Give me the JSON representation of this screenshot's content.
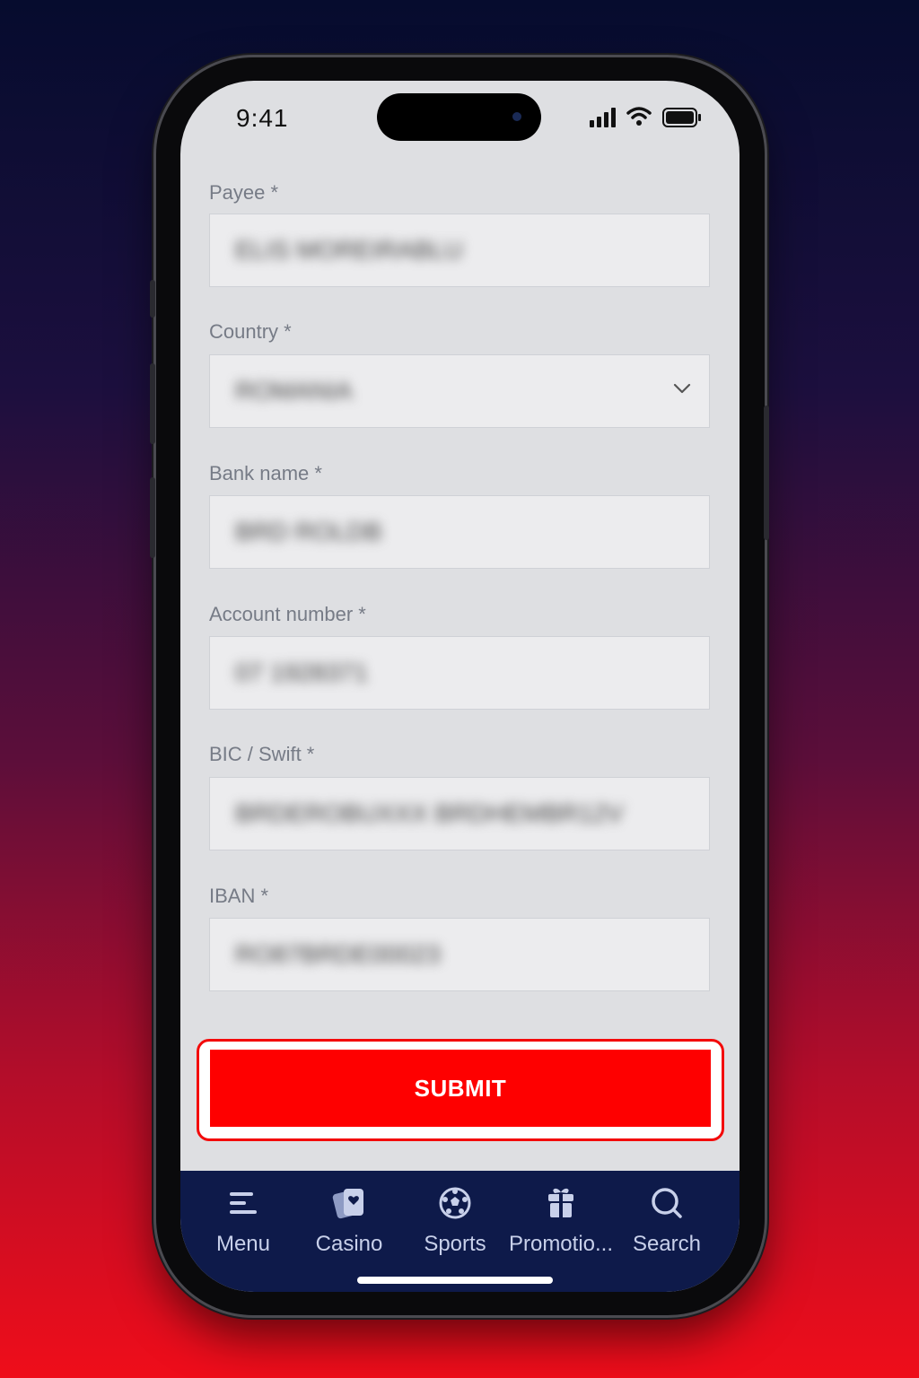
{
  "status_bar": {
    "time": "9:41"
  },
  "form": {
    "fields": [
      {
        "label": "Payee *",
        "value": "ELIS MOREIRABLU"
      },
      {
        "label": "Country *",
        "value": "ROMANIA"
      },
      {
        "label": "Bank name *",
        "value": "BRD ROLDB"
      },
      {
        "label": "Account number *",
        "value": "07 1928371"
      },
      {
        "label": "BIC / Swift *",
        "value": "BRDEROBUXXX BRDHEMBR12V"
      },
      {
        "label": "IBAN *",
        "value": "RO87BRDE00023"
      }
    ],
    "submit_label": "SUBMIT"
  },
  "bottom_nav": {
    "items": [
      {
        "label": "Menu",
        "icon": "menu-icon"
      },
      {
        "label": "Casino",
        "icon": "casino-cards-icon"
      },
      {
        "label": "Sports",
        "icon": "soccer-ball-icon"
      },
      {
        "label": "Promotio...",
        "icon": "gift-icon"
      },
      {
        "label": "Search",
        "icon": "search-icon"
      }
    ]
  },
  "colors": {
    "submit": "#fe0000",
    "nav_bg": "#0e1a4a",
    "screen_bg": "#dedfe2"
  }
}
